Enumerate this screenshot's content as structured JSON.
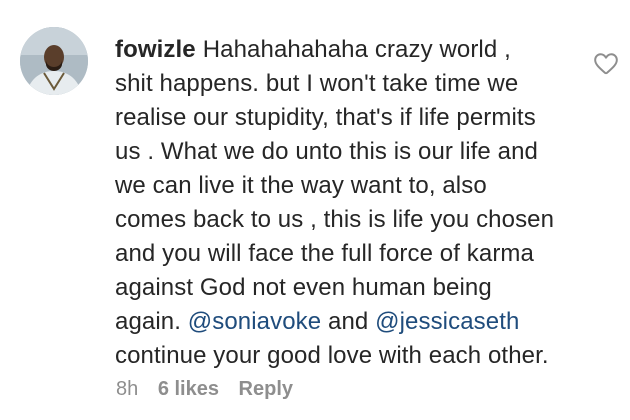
{
  "comment": {
    "username": "fowizle",
    "text_parts": {
      "p1": "Hahahahahaha crazy world , shit happens. but I won't take time we realise our stupidity, that's if life permits us . What we do unto this is our life and we can live it the way want to, also comes back to us , this is life you chosen and you will face the full force of karma against God not even human being again.",
      "mention1": "@soniavoke",
      "p2": "and",
      "mention2": "@jessicaseth",
      "p3": "continue your good love with each other."
    },
    "timestamp": "8h",
    "likes_label": "6 likes",
    "reply_label": "Reply",
    "avatar_icon": "user-avatar",
    "like_icon": "heart-outline-icon"
  },
  "colors": {
    "text": "#262626",
    "meta": "#8e8e8e",
    "mention": "#1f4c7c"
  }
}
